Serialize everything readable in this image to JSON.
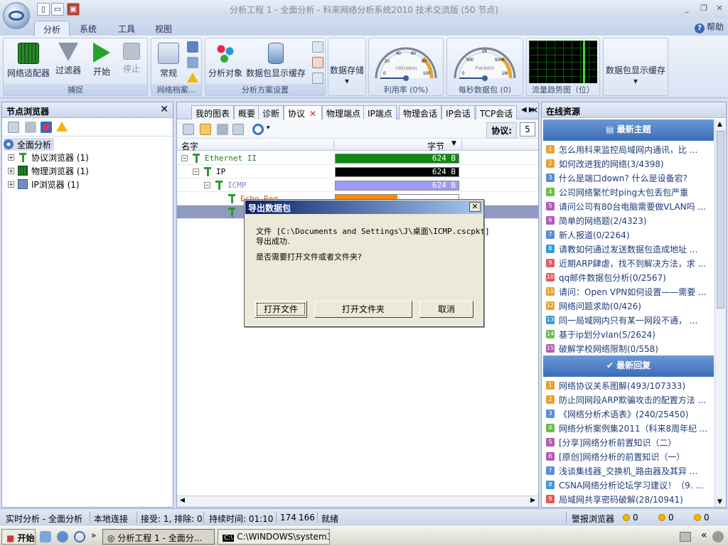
{
  "window": {
    "title": "分析工程 1 - 全面分析 - 科来网络分析系统2010 技术交流版 (50 节点)",
    "min": "_",
    "restore": "❐",
    "close": "✕"
  },
  "menu_tabs": [
    "分析",
    "系统",
    "工具",
    "视图"
  ],
  "help_label": "帮助",
  "ribbon": {
    "capture": {
      "adapter": "网络适配器",
      "filter": "过滤器",
      "start": "开始",
      "stop": "停止",
      "label": "捕捉"
    },
    "profile": {
      "normal": "常规",
      "label": "网络档案..."
    },
    "scheme": {
      "target": "分析对象",
      "buffer": "数据包显示缓存",
      "label": "分析方案设置"
    },
    "storage": {
      "label": "数据存储"
    },
    "util": {
      "label": "利用率  (0%)",
      "center": "Utilization",
      "ticks": [
        "0",
        "20",
        "40",
        "60",
        "80",
        "100"
      ]
    },
    "pps": {
      "label": "每秒数据包  (0)",
      "center": "Packet/s",
      "ticks": [
        "0",
        "500",
        "1K",
        "500K",
        "1M"
      ]
    },
    "trend": {
      "label": "流量趋势图（位）"
    },
    "cache": {
      "label": "数据包显示缓存"
    }
  },
  "left": {
    "title": "节点浏览器",
    "close": "✕",
    "root": "全面分析",
    "items": [
      "协议浏览器  (1)",
      "物理浏览器  (1)",
      "IP浏览器  (1)"
    ]
  },
  "center": {
    "tabs": [
      "我的图表",
      "概要",
      "诊断",
      "协议",
      "物理端点",
      "IP端点",
      "物理会话",
      "IP会话",
      "TCP会话"
    ],
    "proto_label": "协议:",
    "proto_count": "5",
    "col_name": "名字",
    "col_bytes": "字节",
    "rows": [
      {
        "name": "Ethernet II",
        "value": "624  B",
        "color": "#0f8a0f",
        "fill": 1.0
      },
      {
        "name": "IP",
        "value": "624  B",
        "color": "#000000",
        "fill": 1.0
      },
      {
        "name": "ICMP",
        "value": "624  B",
        "color": "#9c9cf5",
        "fill": 1.0
      },
      {
        "name": "Echo Req",
        "value": "312  B",
        "color": "#ff8c00",
        "fill": 0.5
      }
    ]
  },
  "right": {
    "title": "在线资源",
    "latest_topics": "最新主题",
    "latest_replies": "最新回复",
    "topics": [
      "怎么用科来监控局域网内通讯，比 ...",
      "如何改进我的网络(3/4398)",
      "什么是端口down? 什么是设备宕?",
      "公司网络繁忙时ping大包丢包严重",
      "请问公司有80台电脑需要做VLAN吗 ...",
      "简单的网络题(2/4323)",
      "新人报道(0/2264)",
      "请教如何通过发送数据包造成地址 ...",
      "近期ARP肆虐，找不到解决方法，求 ...",
      "qq邮件数据包分析(0/2567)",
      "请问：Open VPN如何设置——需要 ...",
      "网络问题求助(0/426)",
      "同一局域网内只有某一网段不通， ...",
      "基于ip划分vlan(5/2624)",
      "破解学校网络限制(0/558)"
    ],
    "replies": [
      "网络协议关系图解(493/107333)",
      "防止同网段ARP欺骗攻击的配置方法 ...",
      "《网络分析术语表》(240/25450)",
      "网络分析案例集2011（科来8周年纪 ...",
      "[分享]网络分析前置知识（二）",
      "[原创]网络分析的前置知识（一）",
      "浅谈集线器_交换机_路由器及其异 ...",
      "CSNA网络分析论坛学习建议！（9. ...",
      "局域网共享密码破解(28/10941)"
    ]
  },
  "dialog": {
    "title": "导出数据包",
    "line1": "文件 [C:\\Documents and Settings\\J\\桌面\\ICMP.cscpkt]",
    "line2": "导出成功.",
    "question": "是否需要打开文件或者文件夹?",
    "open_file": "打开文件",
    "open_folder": "打开文件夹",
    "cancel": "取消"
  },
  "status": {
    "mode": "实时分析 - 全面分析",
    "local": "本地连接",
    "recv": "接受: 1, 排除: 0",
    "duration": "持续时间: 01:10",
    "n1": "174",
    "n2": "166",
    "ready": "就绪",
    "alarm": "警报浏览器",
    "c1": "0",
    "c2": "0",
    "c3": "0"
  },
  "taskbar": {
    "start": "开始",
    "task1": "分析工程 1 - 全面分...",
    "task2": "C:\\WINDOWS\\system32..."
  }
}
